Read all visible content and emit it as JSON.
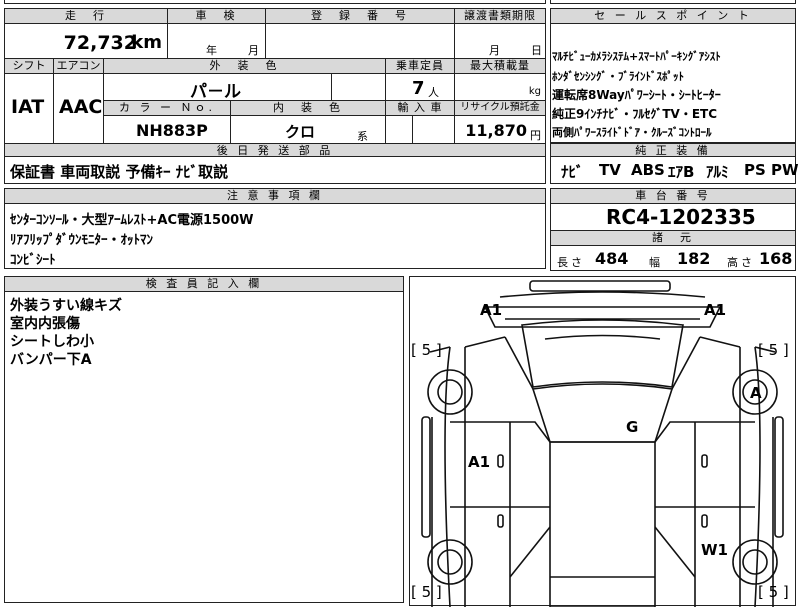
{
  "top_cut": {
    "left": "",
    "mid": "",
    "right": ""
  },
  "mileage": {
    "header": "走　行",
    "value": "72,732",
    "unit": "km"
  },
  "inspection": {
    "header": "車　検",
    "year": "年",
    "month": "月"
  },
  "registration": {
    "header": "登　録　番　号",
    "value": ""
  },
  "transfer_deadline": {
    "header": "譲渡書類期限",
    "month": "月",
    "day": "日"
  },
  "shift": {
    "header": "シフト",
    "value": "IAT"
  },
  "aircon": {
    "header": "エアコン",
    "value": "AAC"
  },
  "exterior_color": {
    "header": "外　装　色",
    "value": "パ－ル"
  },
  "color_no": {
    "header": "カ ラ ー Ｎｏ.",
    "value": "NH883P"
  },
  "interior_color": {
    "header": "内　装　色",
    "value": "クロ",
    "suffix": "系"
  },
  "capacity": {
    "header": "乗車定員",
    "value": "7",
    "unit": "人"
  },
  "max_load": {
    "header": "最大積載量",
    "unit": "kg"
  },
  "import": {
    "header": "輸 入 車",
    "value": ""
  },
  "recycle": {
    "header": "リサイクル預託金",
    "value": "11,870",
    "unit": "円"
  },
  "sales_points": {
    "header": "セ ー ル ス ポ イ ン ト",
    "lines": [
      "ﾏﾙﾁﾋﾞｭｰｶﾒﾗｼｽﾃﾑ+ｽﾏｰﾄﾊﾟｰｷﾝｸﾞｱｼｽﾄ",
      "ﾎﾝﾀﾞｾﾝｼﾝｸﾞ・ﾌﾞﾗｲﾝﾄﾞｽﾎﾟｯﾄ",
      "運転席8Wayﾊﾟﾜｰｼｰﾄ・ｼｰﾄﾋｰﾀｰ",
      "純正9ｲﾝﾁﾅﾋﾞ・ﾌﾙｾｸﾞTV・ETC",
      "両側ﾊﾟﾜｰｽﾗｲﾄﾞﾄﾞｱ・ｸﾙｰｽﾞｺﾝﾄﾛｰﾙ"
    ]
  },
  "later_parts": {
    "header": "後 日 発 送 部 品",
    "value": "保証書 車両取説 予備ｷｰ ﾅﾋﾞ取説"
  },
  "genuine_equipment": {
    "header": "純 正 装 備",
    "items": [
      "ﾅﾋﾞ",
      "TV",
      "ABS",
      "ｴｱB",
      "ｱﾙﾐ",
      "PS",
      "PW"
    ]
  },
  "notes": {
    "header": "注 意 事 項 欄",
    "lines": [
      "ｾﾝﾀｰｺﾝｿｰﾙ・大型ｱｰﾑﾚｽﾄ+AC電源1500W",
      "ﾘｱﾌﾘｯﾌﾟﾀﾞｳﾝﾓﾆﾀｰ・ｵｯﾄﾏﾝ",
      "ｺﾝﾋﾞｼｰﾄ"
    ]
  },
  "chassis": {
    "header": "車 台 番 号",
    "value": "RC4-1202335"
  },
  "dimensions": {
    "header": "諸　元",
    "length_label": "長さ",
    "length": "484",
    "width_label": "幅",
    "width": "182",
    "height_label": "高さ",
    "height": "168"
  },
  "inspector": {
    "header": "検 査 員 記 入 欄",
    "lines": [
      "外装うすい線キズ",
      "室内内張傷",
      "シートしわ小",
      "バンパー下A"
    ]
  },
  "diagram": {
    "marks": [
      {
        "id": "front-left-a1",
        "text": "A1"
      },
      {
        "id": "front-right-a1",
        "text": "A1"
      },
      {
        "id": "tire-fl",
        "text": "[ 5 ]"
      },
      {
        "id": "tire-fr",
        "text": "[ 5 ]"
      },
      {
        "id": "wheel-right-a",
        "text": "A"
      },
      {
        "id": "roof-g",
        "text": "G"
      },
      {
        "id": "left-door-a1",
        "text": "A1"
      },
      {
        "id": "right-rear-w1",
        "text": "W1"
      },
      {
        "id": "tire-rl",
        "text": "[ 5 ]"
      },
      {
        "id": "tire-rr",
        "text": "[ 5 ]"
      }
    ]
  }
}
